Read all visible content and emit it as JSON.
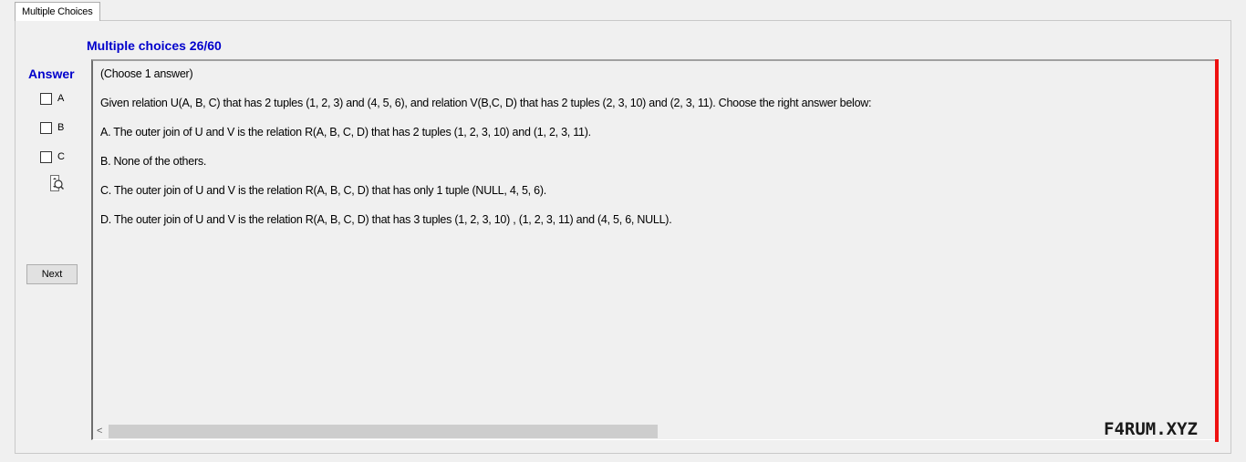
{
  "tabs": [
    {
      "label": "Multiple Choices",
      "active": true
    }
  ],
  "header": {
    "title": "Multiple choices 26/60"
  },
  "answer_panel": {
    "label": "Answer",
    "options": [
      {
        "label": "A",
        "checked": false
      },
      {
        "label": "B",
        "checked": false
      },
      {
        "label": "C",
        "checked": false
      }
    ],
    "zoom_icon": "zoom-icon",
    "next_label": "Next"
  },
  "question": {
    "instruction": "(Choose 1 answer)",
    "stem": "Given relation U(A, B, C) that has 2 tuples (1, 2, 3) and (4, 5, 6), and relation V(B,C, D) that has 2 tuples (2, 3, 10) and (2, 3, 11). Choose the right answer below:",
    "options": [
      "A.  The outer join of U and V is the relation R(A, B, C, D) that has 2 tuples (1, 2, 3, 10) and (1, 2, 3, 11).",
      "B.  None of the others.",
      "C.  The outer join of U and V is the relation R(A, B, C, D) that has only 1 tuple (NULL, 4, 5, 6).",
      "D.  The outer join of U and V is the relation R(A, B, C, D) that has 3 tuples (1, 2, 3, 10) , (1, 2, 3, 11) and (4, 5, 6, NULL)."
    ]
  },
  "scrollbar": {
    "left_arrow": "<"
  },
  "watermark": "F4RUM.XYZ",
  "colors": {
    "accent_blue": "#0000cc",
    "red_bar": "#ee1111"
  }
}
